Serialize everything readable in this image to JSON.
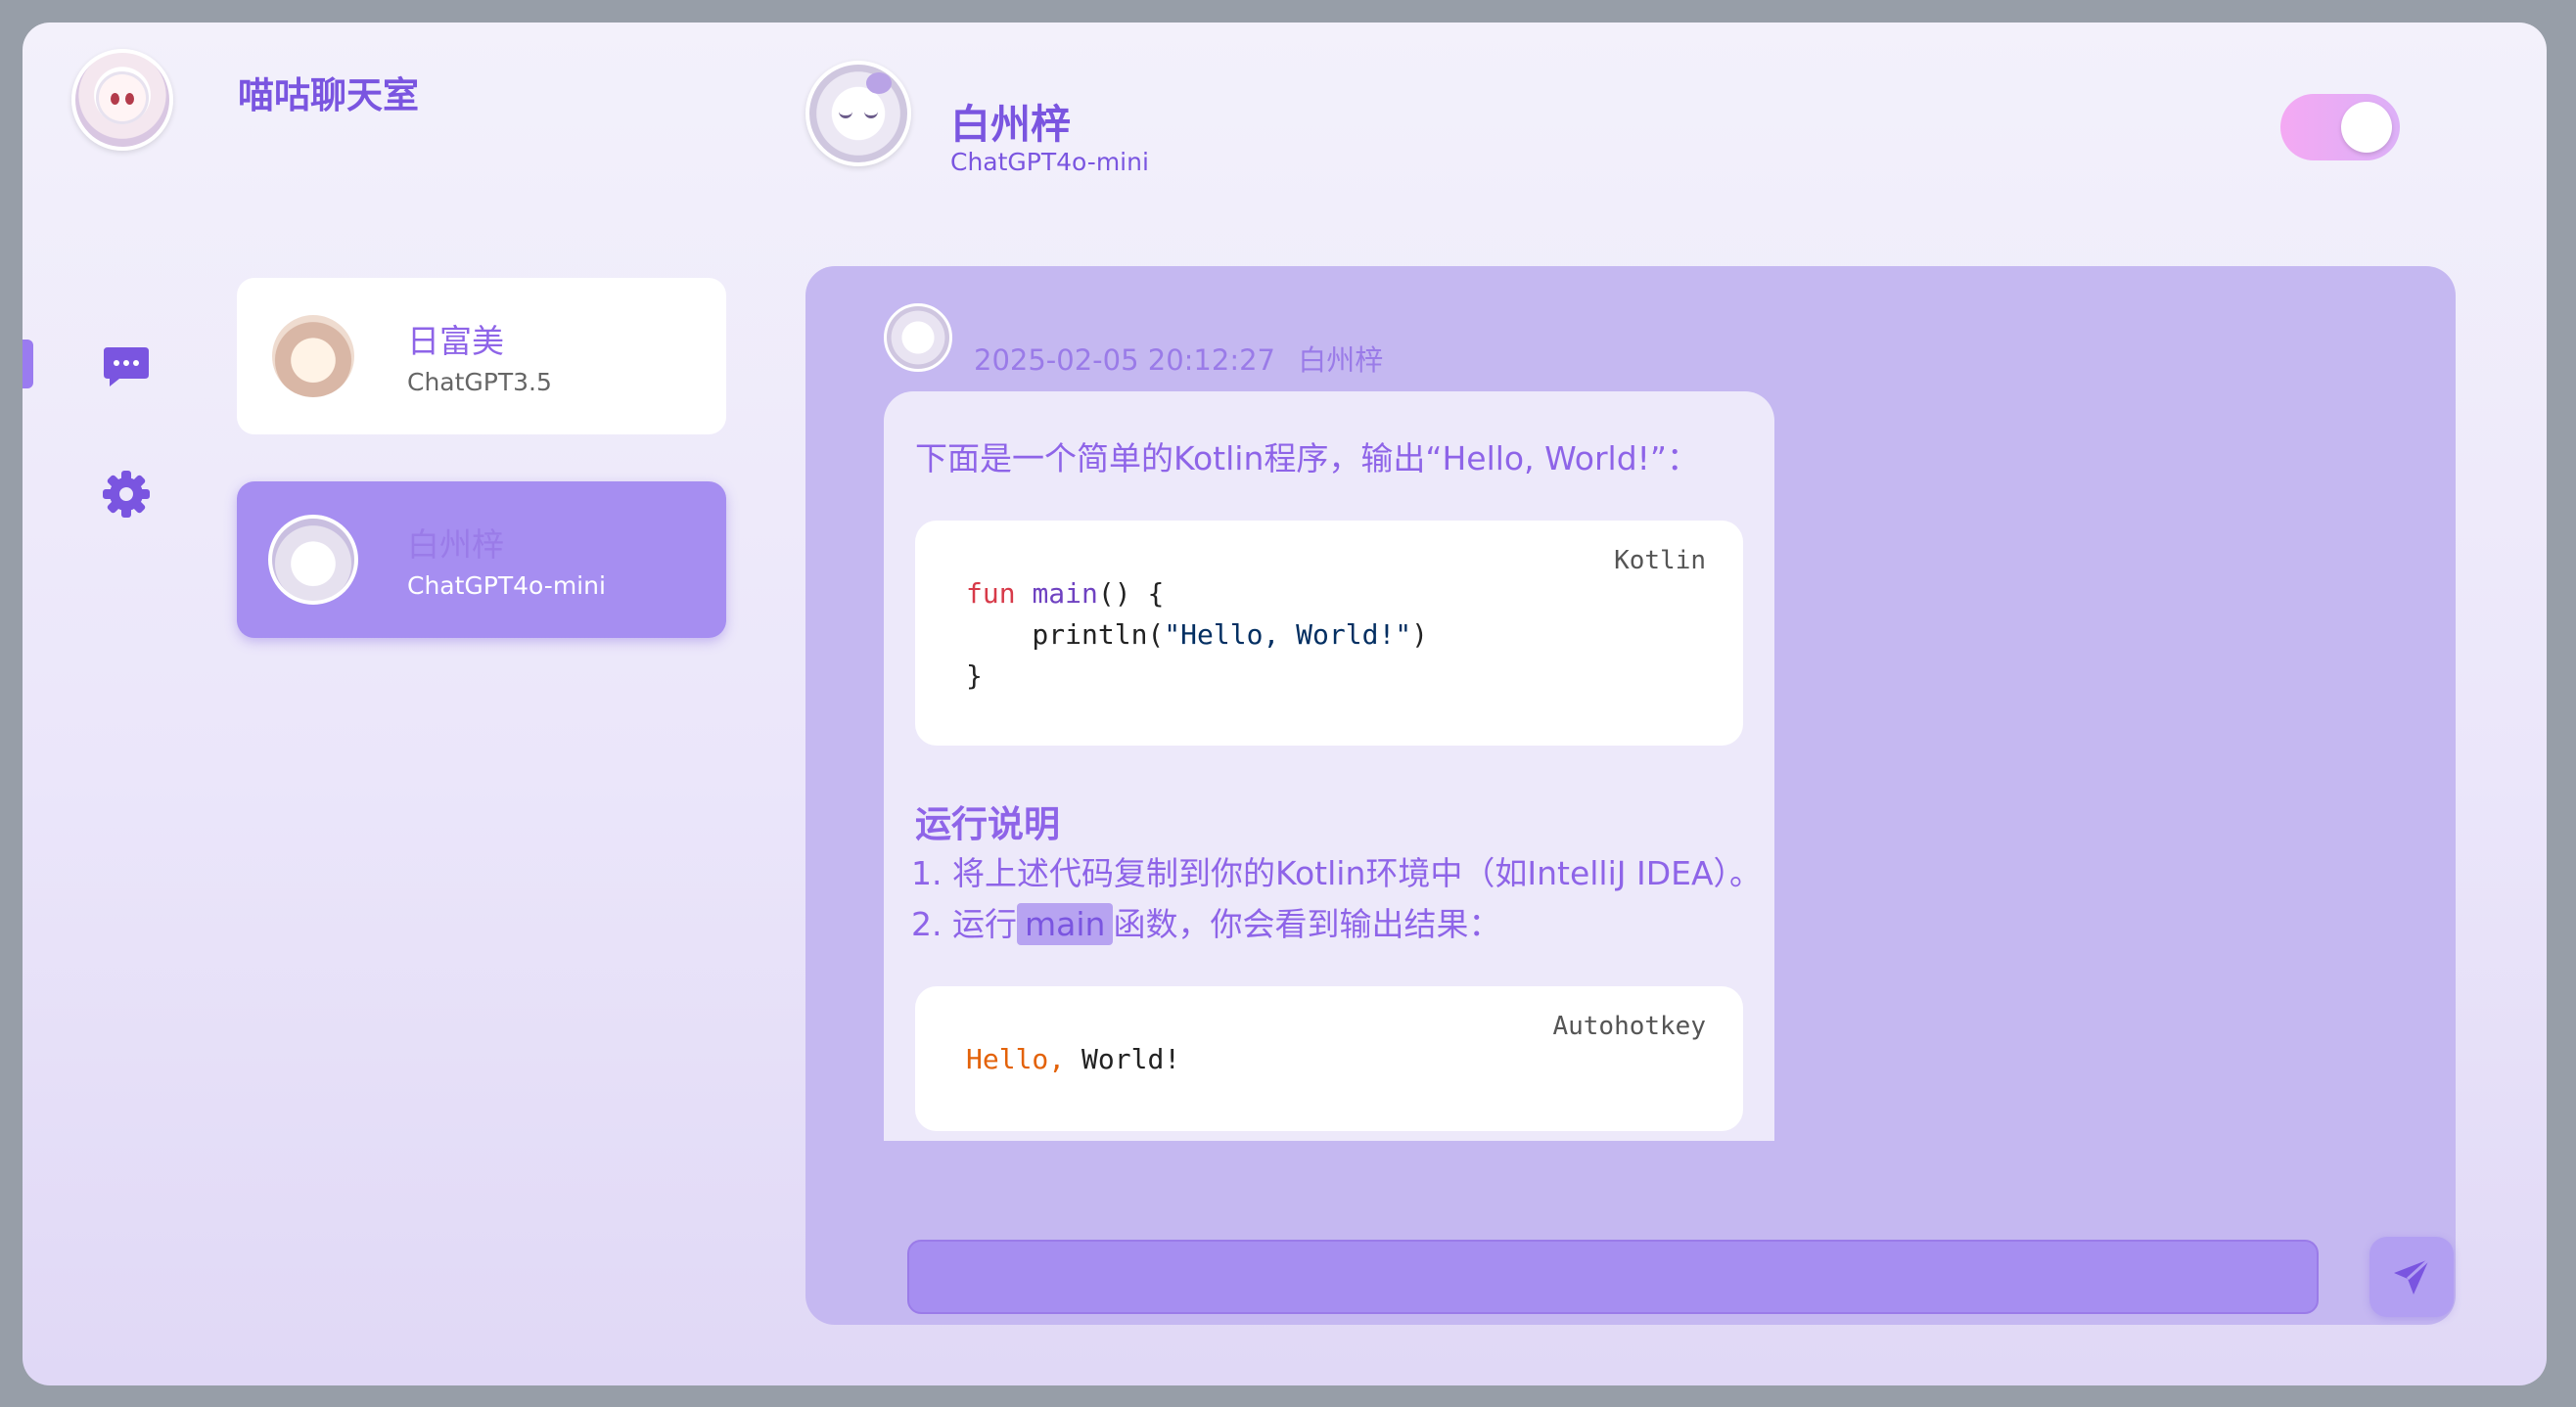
{
  "app": {
    "title": "喵咕聊天室",
    "avatar_icon": "cat-girl-avatar-icon"
  },
  "header": {
    "name": "白州梓",
    "model": "ChatGPT4o-mini",
    "avatar_icon": "white-haired-girl-avatar-icon",
    "theme_toggle_on": true
  },
  "nav": {
    "items": [
      {
        "icon": "chat-bubble-icon",
        "active": true
      },
      {
        "icon": "gear-icon",
        "active": false
      }
    ]
  },
  "contacts": [
    {
      "name": "日富美",
      "model": "ChatGPT3.5",
      "selected": false
    },
    {
      "name": "白州梓",
      "model": "ChatGPT4o-mini",
      "selected": true
    }
  ],
  "message": {
    "timestamp": "2025-02-05 20:12:27",
    "sender": "白州梓",
    "intro": "下面是一个简单的Kotlin程序，输出“Hello, World!”：",
    "code1": {
      "lang": "Kotlin",
      "kw": "fun",
      "fn": "main",
      "line1_rest": "() {",
      "line2_pre": "    println(",
      "line2_str": "\"Hello, World!\"",
      "line2_post": ")",
      "line3": "}"
    },
    "section_heading": "运行说明",
    "step1": "1. 将上述代码复制到你的Kotlin环境中（如IntelliJ IDEA）。",
    "step2_pre": "2. 运行",
    "step2_code": "main",
    "step2_post": "函数，你会看到输出结果：",
    "code2": {
      "lang": "Autohotkey",
      "part1": "Hello,",
      "part2": " World!"
    }
  },
  "composer": {
    "value": "",
    "send_icon": "paper-plane-icon"
  },
  "colors": {
    "accent": "#7a55e0",
    "panel": "#c5b8f1",
    "selected": "#a68ef1",
    "toggle": "#f4a9f3"
  }
}
